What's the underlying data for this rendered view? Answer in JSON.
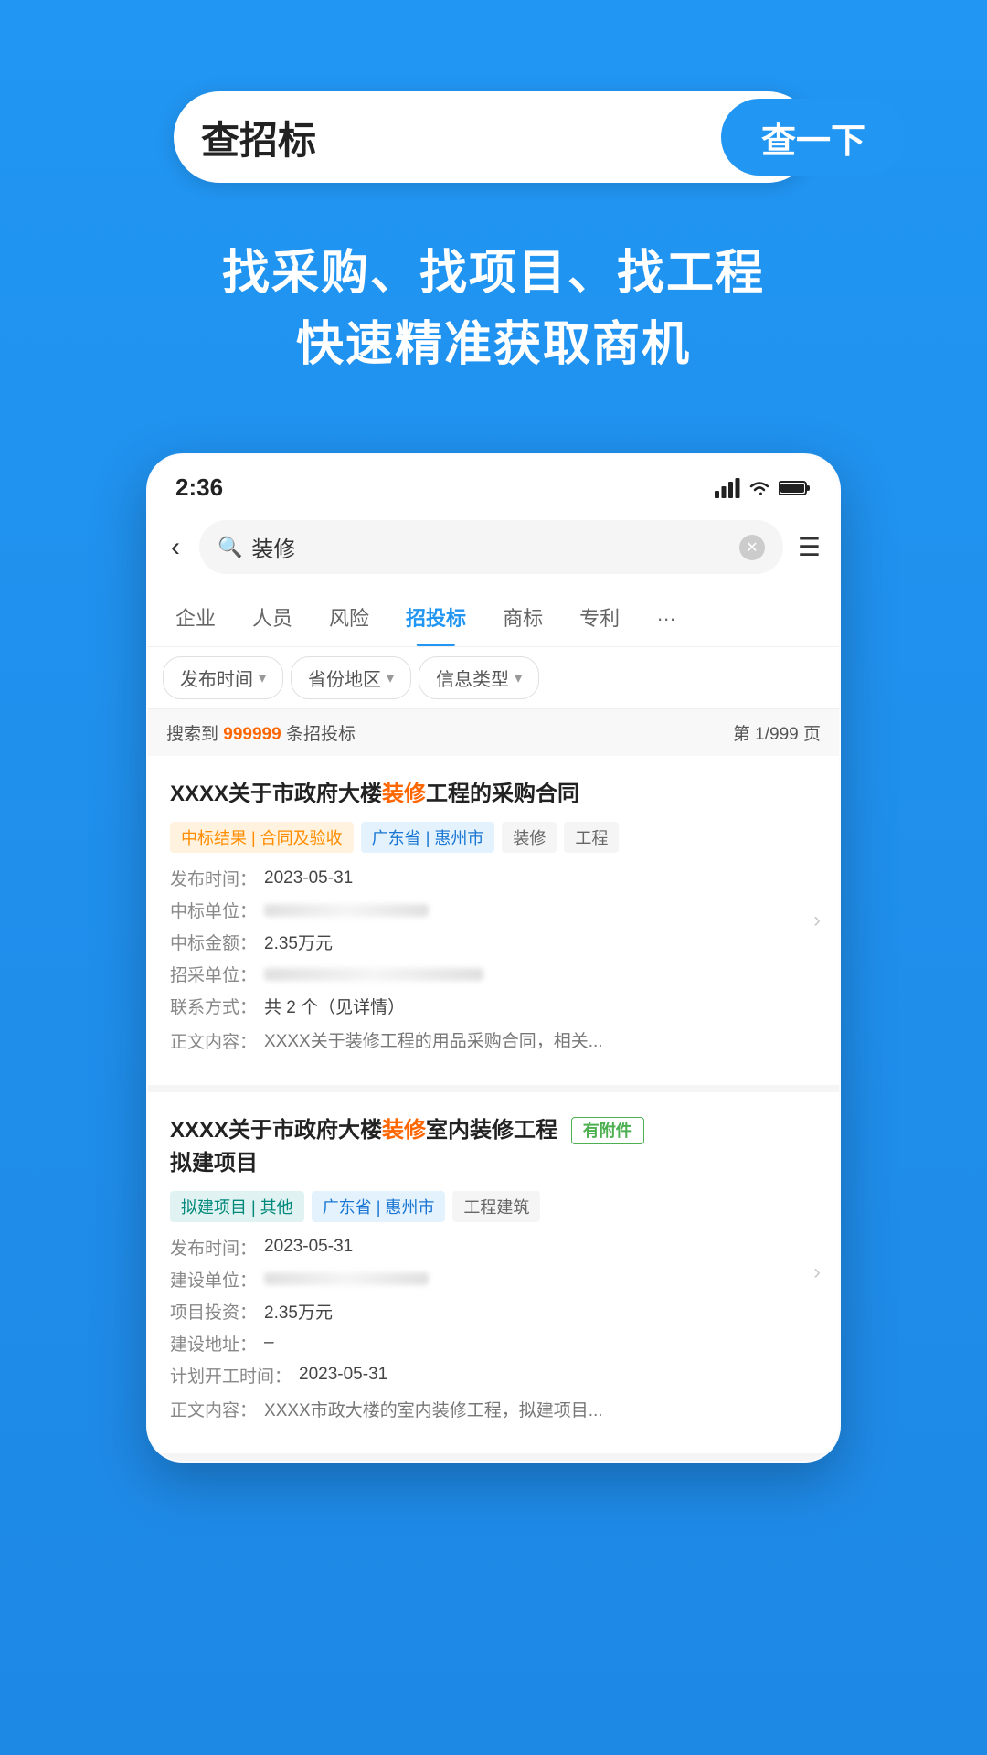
{
  "page": {
    "background_color": "#2196F3"
  },
  "header": {
    "search_placeholder": "查招标",
    "search_button_label": "查一下",
    "subtitle_line1": "找采购、找项目、找工程",
    "subtitle_line2": "快速精准获取商机"
  },
  "phone": {
    "status_bar": {
      "time": "2:36",
      "signal": "▌▌▌",
      "wifi": "wifi",
      "battery": "battery"
    },
    "search": {
      "keyword": "装修",
      "placeholder": "装修"
    },
    "categories": [
      {
        "label": "企业",
        "active": false
      },
      {
        "label": "人员",
        "active": false
      },
      {
        "label": "风险",
        "active": false
      },
      {
        "label": "招投标",
        "active": true
      },
      {
        "label": "商标",
        "active": false
      },
      {
        "label": "专利",
        "active": false
      },
      {
        "label": "…",
        "active": false
      }
    ],
    "filters": [
      {
        "label": "发布时间",
        "has_arrow": true
      },
      {
        "label": "省份地区",
        "has_arrow": true
      },
      {
        "label": "信息类型",
        "has_arrow": true
      }
    ],
    "results_info": {
      "prefix": "搜索到 ",
      "count": "999999",
      "suffix": " 条招投标",
      "page": "第 1/999 页"
    },
    "cards": [
      {
        "title_before_highlight": "XXXX关于市政府大楼",
        "highlight": "装修",
        "title_after_highlight": "工程的采购合同",
        "has_attachment": false,
        "tags": [
          {
            "text": "中标结果 | 合同及验收",
            "type": "orange"
          },
          {
            "text": "广东省 | 惠州市",
            "type": "blue"
          },
          {
            "text": "装修",
            "type": "gray"
          },
          {
            "text": "工程",
            "type": "gray"
          }
        ],
        "fields": [
          {
            "label": "发布时间：",
            "value": "2023-05-31",
            "blurred": false
          },
          {
            "label": "中标单位：",
            "value": "",
            "blurred": true
          },
          {
            "label": "中标金额：",
            "value": "2.35万元",
            "blurred": false
          },
          {
            "label": "招采单位：",
            "value": "",
            "blurred": true
          },
          {
            "label": "联系方式：",
            "value": "共 2 个（见详情）",
            "blurred": false
          },
          {
            "label": "正文内容：",
            "value": "XXXX关于装修工程的用品采购合同，相关...",
            "blurred": false
          }
        ]
      },
      {
        "title_before_highlight": "XXXX关于市政府大楼",
        "highlight": "装修",
        "title_after_highlight": "室内装修工程\n拟建项目",
        "has_attachment": true,
        "attachment_label": "有附件",
        "tags": [
          {
            "text": "拟建项目 | 其他",
            "type": "teal"
          },
          {
            "text": "广东省 | 惠州市",
            "type": "blue"
          },
          {
            "text": "工程建筑",
            "type": "gray"
          }
        ],
        "fields": [
          {
            "label": "发布时间：",
            "value": "2023-05-31",
            "blurred": false
          },
          {
            "label": "建设单位：",
            "value": "",
            "blurred": true
          },
          {
            "label": "项目投资：",
            "value": "2.35万元",
            "blurred": false
          },
          {
            "label": "建设地址：",
            "value": "–",
            "blurred": false
          },
          {
            "label": "计划开工时间：",
            "value": "2023-05-31",
            "blurred": false
          },
          {
            "label": "正文内容：",
            "value": "XXXX市政大楼的室内装修工程，拟建项目...",
            "blurred": false
          }
        ]
      }
    ]
  }
}
